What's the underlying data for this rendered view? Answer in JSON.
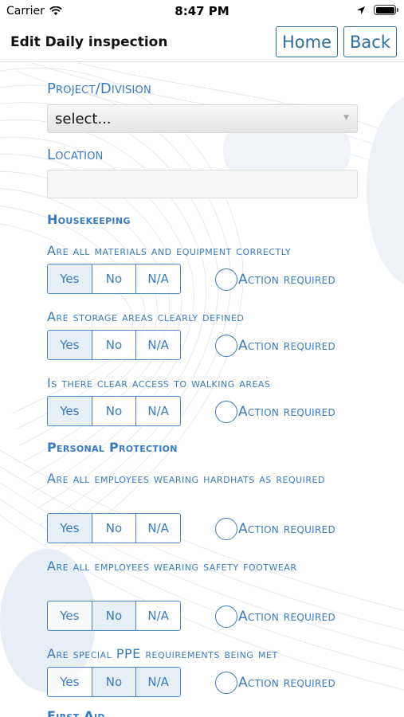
{
  "status_bar": {
    "carrier": "Carrier",
    "time": "8:47 PM"
  },
  "nav": {
    "title": "Edit Daily inspection",
    "home_label": "Home",
    "back_label": "Back"
  },
  "form": {
    "project_label": "Project/Division",
    "project_value": "select...",
    "location_label": "Location",
    "location_value": ""
  },
  "sections": [
    {
      "title": "Housekeeping",
      "questions": [
        {
          "text": "Are all materials and equipment correctly",
          "selected": "Yes"
        },
        {
          "text": "Are storage areas clearly defined",
          "selected": "Yes"
        },
        {
          "text": "Is there clear access to walking areas",
          "selected": "Yes"
        }
      ]
    },
    {
      "title": "Personal Protection",
      "questions": [
        {
          "text": "Are all employees wearing hardhats as required",
          "selected": "Yes"
        },
        {
          "text": "Are all employees wearing safety footwear",
          "selected": "No"
        },
        {
          "text": "Are special PPE requirements being met",
          "selected": "No"
        }
      ]
    },
    {
      "title": "First Aid"
    }
  ],
  "options": {
    "yes": "Yes",
    "no": "No",
    "na": "N/A"
  },
  "action_label": "Action required",
  "colors": {
    "accent": "#3a7bbf",
    "nav_border": "#2c6fa0"
  }
}
